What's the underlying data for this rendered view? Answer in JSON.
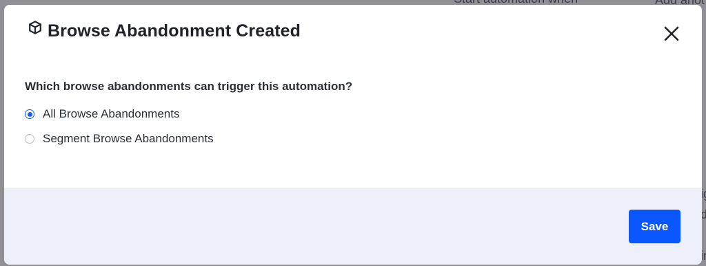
{
  "background": {
    "top_text_1": "Start automation when",
    "top_text_2": "Add anot",
    "side_text_1": "ig",
    "side_text_2": "d",
    "side_text_3": "in"
  },
  "modal": {
    "header_icon": "cube-icon",
    "title": "Browse Abandonment Created",
    "close_icon": "close-icon",
    "question": "Which browse abandonments can trigger this automation?",
    "options": [
      {
        "label": "All Browse Abandonments",
        "selected": true
      },
      {
        "label": "Segment Browse Abandonments",
        "selected": false
      }
    ],
    "save_label": "Save"
  },
  "colors": {
    "accent": "#0b57ff",
    "footer_bg": "#edf0f8",
    "backdrop": "#8f8f95"
  }
}
